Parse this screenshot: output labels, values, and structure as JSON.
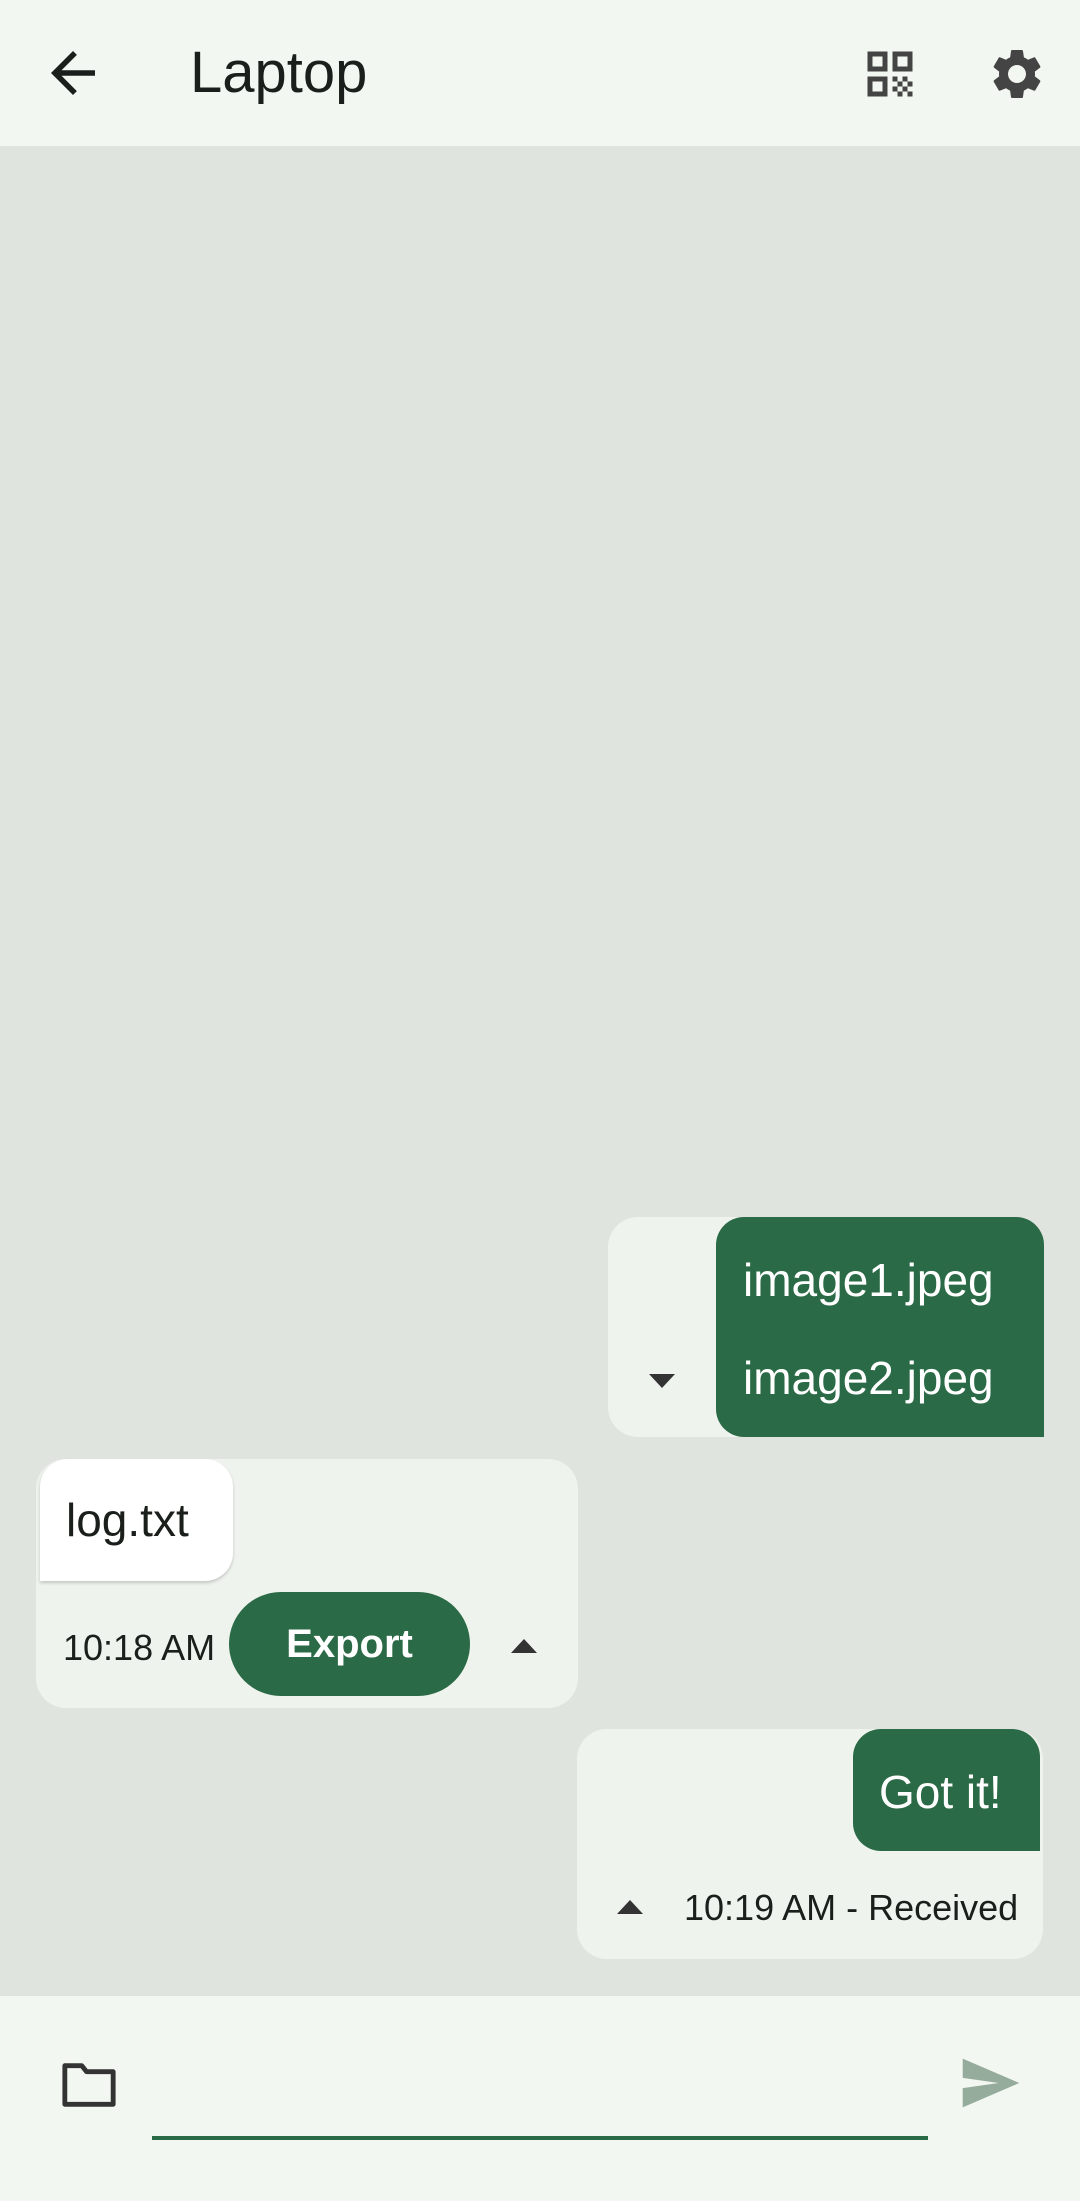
{
  "app_bar": {
    "title": "Laptop",
    "icons": [
      "arrow-back-icon",
      "qr-code-icon",
      "settings-gear-icon"
    ]
  },
  "colors": {
    "accent": "#2b6a46",
    "surface": "#f3f7f1",
    "chat_background": "#e0e4de",
    "card": "#eff3ed"
  },
  "messages": [
    {
      "direction": "sent",
      "files": [
        "image1.jpeg",
        "image2.jpeg"
      ],
      "expand_icon": "caret-down-icon"
    },
    {
      "direction": "received",
      "files": [
        "log.txt"
      ],
      "time": "10:18 AM",
      "action_label": "Export",
      "expand_icon": "caret-up-icon"
    },
    {
      "direction": "sent",
      "text": "Got it!",
      "status": "10:19 AM - Received",
      "expand_icon": "caret-up-icon"
    }
  ],
  "composer": {
    "value": "",
    "placeholder": "",
    "icons": [
      "folder-icon",
      "send-icon"
    ]
  }
}
